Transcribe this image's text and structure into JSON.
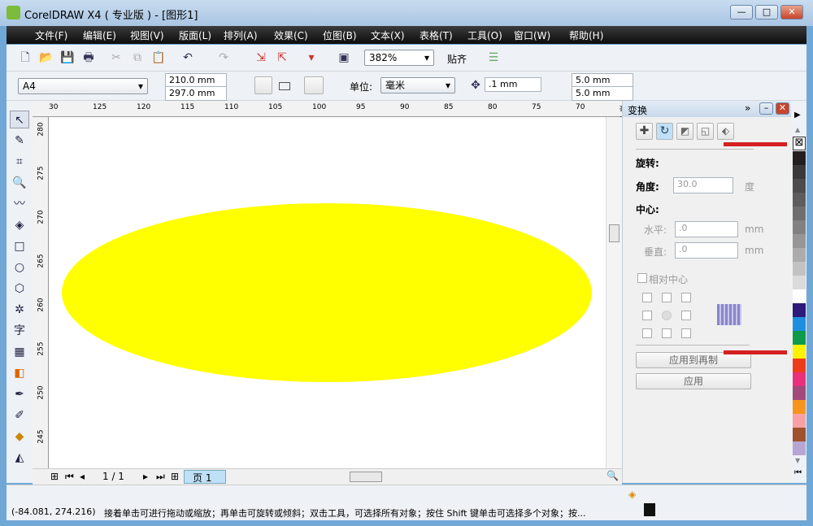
{
  "window": {
    "title": "CorelDRAW X4 ( 专业版 ) - [图形1]",
    "min": "—",
    "max": "□",
    "close": "✕"
  },
  "menu": [
    "文件(F)",
    "编辑(E)",
    "视图(V)",
    "版面(L)",
    "排列(A)",
    "效果(C)",
    "位图(B)",
    "文本(X)",
    "表格(T)",
    "工具(O)",
    "窗口(W)",
    "帮助(H)"
  ],
  "toolbar": {
    "zoom": "382%",
    "snap": "贴齐"
  },
  "property": {
    "page_size": "A4",
    "width": "210.0 mm",
    "height": "297.0 mm",
    "unit_label": "单位:",
    "unit": "毫米",
    "nudge": ".1 mm",
    "dup_x": "5.0 mm",
    "dup_y": "5.0 mm"
  },
  "ruler_top": [
    "30",
    "125",
    "120",
    "115",
    "110",
    "105",
    "100",
    "95",
    "90",
    "85",
    "80",
    "75",
    "70",
    "毫米"
  ],
  "ruler_left": [
    "280",
    "275",
    "270",
    "265",
    "260",
    "255",
    "250",
    "245"
  ],
  "canvas": {
    "shape": "ellipse",
    "fill": "#ffff00"
  },
  "page_nav": {
    "counter": "1 / 1",
    "tab": "页 1"
  },
  "docker": {
    "title": "变换",
    "section": "旋转:",
    "angle_label": "角度:",
    "angle": "30.0",
    "angle_unit": "度",
    "center_label": "中心:",
    "h_label": "水平:",
    "h": ".0",
    "h_unit": "mm",
    "v_label": "垂直:",
    "v": ".0",
    "v_unit": "mm",
    "relative": "相对中心",
    "apply_dup": "应用到再制",
    "apply": "应用"
  },
  "palette": [
    "#231f20",
    "#3a3838",
    "#4d4b4b",
    "#5e5c5c",
    "#706e6e",
    "#838181",
    "#979595",
    "#adabab",
    "#c3c2c2",
    "#dcdbdb",
    "#ffffff",
    "#2e1a7a",
    "#1e8ee0",
    "#0e9a48",
    "#fff200",
    "#ee3d1b",
    "#e8317a",
    "#a24a7a",
    "#f7941d",
    "#f7a1a6",
    "#a0522d",
    "#b7a6d4"
  ],
  "status": {
    "coords": "(-84.081, 274.216)",
    "hint": "接着单击可进行拖动或缩放；再单击可旋转或倾斜；双击工具，可选择所有对象；按住 Shift 键单击可选择多个对象；按..."
  }
}
